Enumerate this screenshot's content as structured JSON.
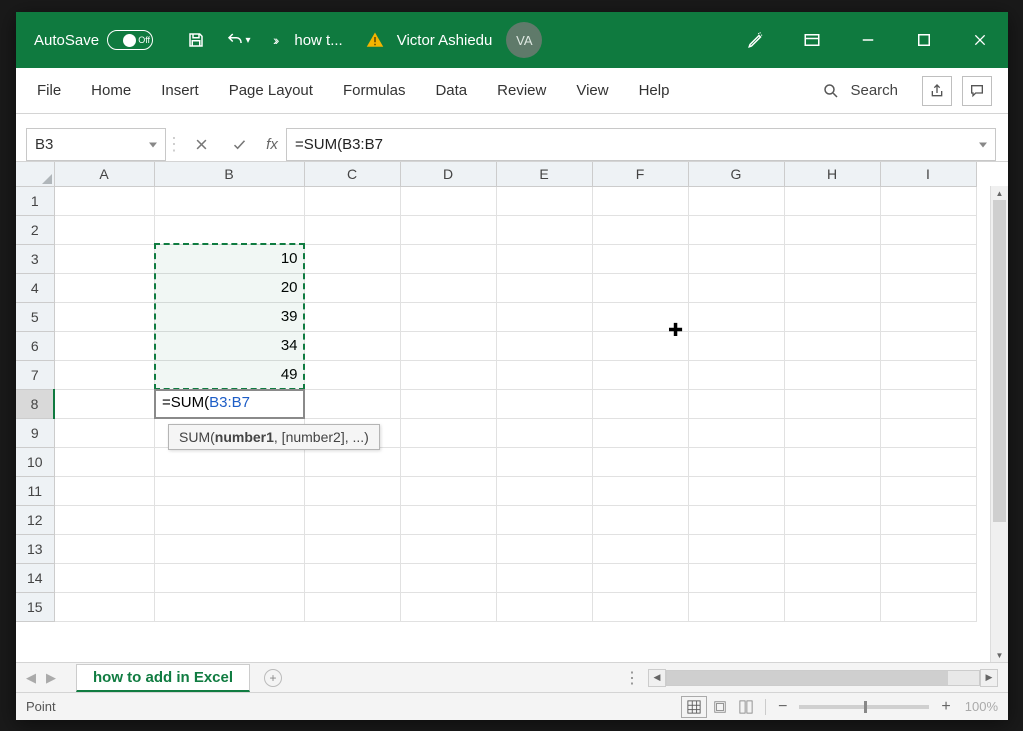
{
  "titlebar": {
    "autosave_label": "AutoSave",
    "autosave_state": "Off",
    "document_name": "how t...",
    "user_name": "Victor Ashiedu",
    "user_initials": "VA"
  },
  "ribbon": {
    "tabs": [
      "File",
      "Home",
      "Insert",
      "Page Layout",
      "Formulas",
      "Data",
      "Review",
      "View",
      "Help"
    ],
    "search_label": "Search"
  },
  "formula_bar": {
    "name_box": "B3",
    "fx_label": "fx",
    "formula": "=SUM(B3:B7"
  },
  "grid": {
    "columns": [
      "A",
      "B",
      "C",
      "D",
      "E",
      "F",
      "G",
      "H",
      "I"
    ],
    "rows": [
      1,
      2,
      3,
      4,
      5,
      6,
      7,
      8,
      9,
      10,
      11,
      12,
      13,
      14,
      15
    ],
    "active_row": 8,
    "data": {
      "B3": "10",
      "B4": "20",
      "B5": "39",
      "B6": "34",
      "B7": "49"
    },
    "editing_cell": "B8",
    "editing_text_prefix": "=SUM(",
    "editing_text_range": "B3:B7",
    "tooltip_func": "SUM(",
    "tooltip_arg1": "number1",
    "tooltip_rest": ", [number2], ...)"
  },
  "sheet_tabs": {
    "active_tab": "how to add in Excel"
  },
  "status": {
    "mode": "Point",
    "zoom": "100%"
  }
}
